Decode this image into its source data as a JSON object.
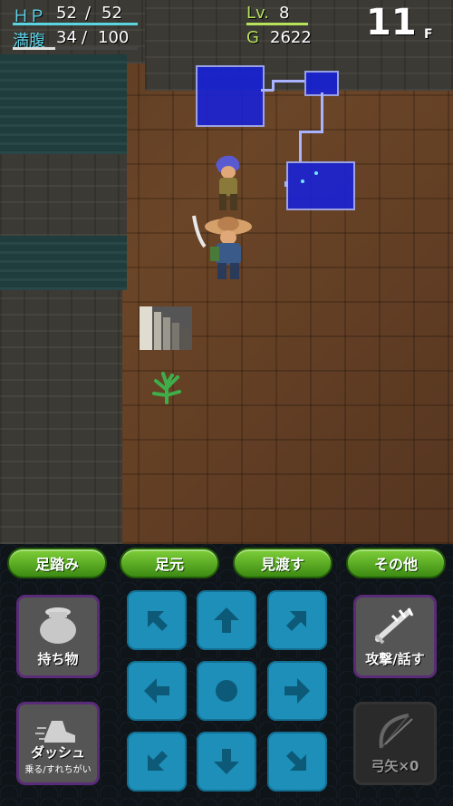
{
  "hud": {
    "hp_label": "ＨＰ",
    "hp_current": "52",
    "hp_sep": "/",
    "hp_max": "52",
    "fullness_label": "満腹",
    "fullness_current": "34",
    "fullness_sep": "/",
    "fullness_max": "100",
    "level_label": "Lv.",
    "level_value": "8",
    "gold_label": "G",
    "gold_value": "2622",
    "floor_number": "11",
    "floor_unit": "F",
    "hp_ratio": 1.0,
    "fullness_ratio": 0.34
  },
  "action_buttons": {
    "stomp": "足踏み",
    "feet": "足元",
    "look_around": "見渡す",
    "other": "その他"
  },
  "side_buttons": {
    "items": "持ち物",
    "attack_talk": "攻撃/話す",
    "dash": "ダッシュ",
    "dash_sub": "乗る/すれちがい",
    "arrows": "弓矢×0"
  },
  "colors": {
    "hp_bar": "#5bd6e0",
    "fullness_bar": "#e0e0e0",
    "action_button": "#5cb020",
    "dpad": "#1d8fb8",
    "minimap": "#1520e0"
  },
  "icons": {
    "dpad": [
      "arrow-up-left-icon",
      "arrow-up-icon",
      "arrow-up-right-icon",
      "arrow-left-icon",
      "circle-icon",
      "arrow-right-icon",
      "arrow-down-left-icon",
      "arrow-down-icon",
      "arrow-down-right-icon"
    ]
  }
}
